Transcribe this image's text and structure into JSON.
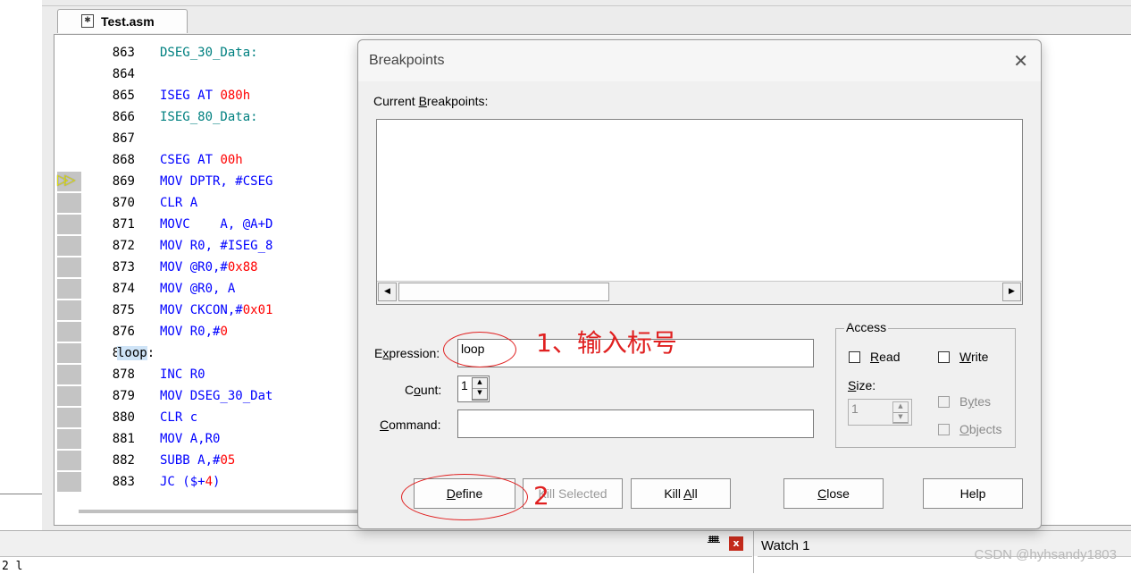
{
  "editor": {
    "tab_label": "Test.asm",
    "lines": [
      {
        "n": "863",
        "parts": [
          {
            "t": "DSEG_30_Data:",
            "c": "lbl"
          }
        ]
      },
      {
        "n": "864",
        "parts": []
      },
      {
        "n": "865",
        "parts": [
          {
            "t": "ISEG AT ",
            "c": "kw"
          },
          {
            "t": "080h",
            "c": "num"
          }
        ]
      },
      {
        "n": "866",
        "parts": [
          {
            "t": "ISEG_80_Data:",
            "c": "lbl"
          }
        ]
      },
      {
        "n": "867",
        "parts": []
      },
      {
        "n": "868",
        "parts": [
          {
            "t": "CSEG AT ",
            "c": "kw"
          },
          {
            "t": "00h",
            "c": "num"
          }
        ]
      },
      {
        "n": "869",
        "parts": [
          {
            "t": "MOV DPTR, #CSEG",
            "c": "kw"
          }
        ]
      },
      {
        "n": "870",
        "parts": [
          {
            "t": "CLR A",
            "c": "kw"
          }
        ]
      },
      {
        "n": "871",
        "parts": [
          {
            "t": "MOVC    A, @A+D",
            "c": "kw"
          }
        ]
      },
      {
        "n": "872",
        "parts": [
          {
            "t": "MOV R0, #ISEG_8",
            "c": "kw"
          }
        ]
      },
      {
        "n": "873",
        "parts": [
          {
            "t": "MOV @R0,#",
            "c": "kw"
          },
          {
            "t": "0x88",
            "c": "num"
          }
        ]
      },
      {
        "n": "874",
        "parts": [
          {
            "t": "MOV @R0, A",
            "c": "kw"
          }
        ]
      },
      {
        "n": "875",
        "parts": [
          {
            "t": "MOV CKCON,#",
            "c": "kw"
          },
          {
            "t": "0x01",
            "c": "num"
          }
        ]
      },
      {
        "n": "876",
        "parts": [
          {
            "t": "MOV R0,#",
            "c": "kw"
          },
          {
            "t": "0",
            "c": "num"
          }
        ]
      },
      {
        "n": "877",
        "parts": [
          {
            "t": "loop",
            "c": "hl"
          },
          {
            "t": ":",
            "c": ""
          }
        ],
        "label_line": true
      },
      {
        "n": "878",
        "parts": [
          {
            "t": "INC R0",
            "c": "kw"
          }
        ]
      },
      {
        "n": "879",
        "parts": [
          {
            "t": "MOV DSEG_30_Dat",
            "c": "kw"
          }
        ]
      },
      {
        "n": "880",
        "parts": [
          {
            "t": "CLR c",
            "c": "kw"
          }
        ]
      },
      {
        "n": "881",
        "parts": [
          {
            "t": "MOV A,R0",
            "c": "kw"
          }
        ]
      },
      {
        "n": "882",
        "parts": [
          {
            "t": "SUBB A,#",
            "c": "kw"
          },
          {
            "t": "05",
            "c": "num"
          }
        ]
      },
      {
        "n": "883",
        "parts": [
          {
            "t": "JC ($+",
            "c": "kw"
          },
          {
            "t": "4",
            "c": "num"
          },
          {
            "t": ")",
            "c": "kw"
          }
        ]
      }
    ],
    "exec_arrow": "▷▷"
  },
  "bottom": {
    "pin": "📌",
    "close": "x",
    "watch_title": "Watch 1",
    "output_text": "2  l",
    "watermark": "CSDN @hyhsandy1803"
  },
  "dialog": {
    "title": "Breakpoints",
    "close_glyph": "✕",
    "current_breakpoints_pre": "Current ",
    "current_breakpoints_u": "B",
    "current_breakpoints_post": "reakpoints:",
    "expression_pre": "E",
    "expression_u": "x",
    "expression_post": "pression:",
    "expression_value": "loop",
    "count_pre": "C",
    "count_u": "o",
    "count_post": "unt:",
    "count_value": "1",
    "command_pre": "",
    "command_u": "C",
    "command_post": "ommand:",
    "command_value": "",
    "access_label": "Access",
    "read_u": "R",
    "read_post": "ead",
    "write_u": "W",
    "write_post": "rite",
    "size_u": "S",
    "size_post": "ize:",
    "size_value": "1",
    "bytes_pre": "B",
    "bytes_u": "y",
    "bytes_post": "tes",
    "objects_u": "O",
    "objects_post": "bjects",
    "define_u": "D",
    "define_post": "efine",
    "kill_selected": "Kill Selected",
    "kill_all_pre": "Kill ",
    "kill_all_u": "A",
    "kill_all_post": "ll",
    "close_u": "C",
    "close_post": "lose",
    "help": "Help"
  },
  "annotations": {
    "step1": "1、输入标号",
    "step2": "2"
  },
  "colors": {
    "annotation_red": "#e02020",
    "keyword_blue": "#0000ff",
    "number_red": "#ff0000",
    "label_teal": "#008080"
  }
}
